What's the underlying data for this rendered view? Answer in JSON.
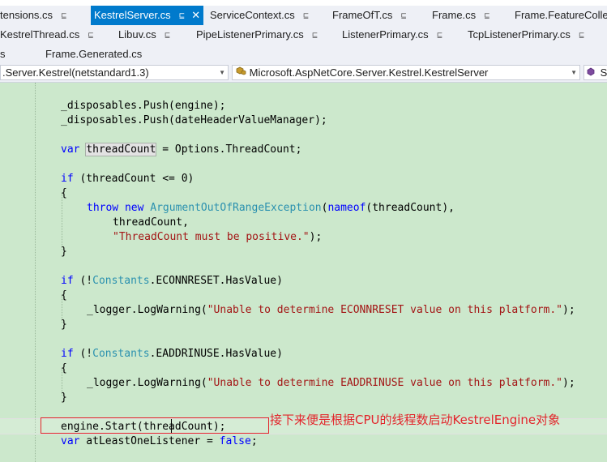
{
  "tabs": {
    "row1": [
      {
        "label": "tensions.cs",
        "active": false
      },
      {
        "label": "KestrelServer.cs",
        "active": true
      },
      {
        "label": "ServiceContext.cs",
        "active": false
      },
      {
        "label": "FrameOfT.cs",
        "active": false
      },
      {
        "label": "Frame.cs",
        "active": false
      },
      {
        "label": "Frame.FeatureColle",
        "active": false
      }
    ],
    "row2": [
      {
        "label": "KestrelThread.cs"
      },
      {
        "label": "Libuv.cs"
      },
      {
        "label": "PipeListenerPrimary.cs"
      },
      {
        "label": "ListenerPrimary.cs"
      },
      {
        "label": "TcpListenerPrimary.cs"
      }
    ],
    "row3": [
      {
        "label": "s"
      },
      {
        "label": "Frame.Generated.cs"
      }
    ],
    "pin_glyph": "⊑",
    "close_glyph": "✕"
  },
  "navbar": {
    "project": ".Server.Kestrel(netstandard1.3)",
    "type": "Microsoft.AspNetCore.Server.Kestrel.KestrelServer",
    "member": "S"
  },
  "code": {
    "l1_a": "_disposables",
    "l1_b": ".Push(engine);",
    "l2_a": "_disposables",
    "l2_b": ".Push(dateHeaderValueManager);",
    "l3_kw": "var",
    "l3_var": "threadCount",
    "l3_rest": " = Options.ThreadCount;",
    "l4_kw": "if",
    "l4_rest": " (threadCount <= 0)",
    "brace_open": "{",
    "brace_close": "}",
    "l5_kw1": "throw",
    "l5_kw2": "new",
    "l5_type": "ArgumentOutOfRangeException",
    "l5_kw3": "nameof",
    "l5_rest": "(threadCount),",
    "l5_paren": "(",
    "l6": "threadCount,",
    "l7_str": "\"ThreadCount must be positive.\"",
    "l7_rest": ");",
    "l8_kw": "if",
    "l8_pre": " (!",
    "l8_type": "Constants",
    "l8_rest": ".ECONNRESET.HasValue)",
    "l9_a": "_logger",
    "l9_b": ".LogWarning(",
    "l9_str": "\"Unable to determine ECONNRESET value on this platform.\"",
    "l9_end": ");",
    "l10_kw": "if",
    "l10_pre": " (!",
    "l10_type": "Constants",
    "l10_rest": ".EADDRINUSE.HasValue)",
    "l11_a": "_logger",
    "l11_b": ".LogWarning(",
    "l11_str": "\"Unable to determine EADDRINUSE value on this platform.\"",
    "l11_end": ");",
    "l12": "engine.Start(threadCount);",
    "l13_kw": "var",
    "l13_rest": " atLeastOneListener = ",
    "l13_kw2": "false",
    "l13_end": ";"
  },
  "annotation": "接下来便是根据CPU的线程数启动KestrelEngine对象",
  "colors": {
    "editor_bg": "#cce8cc",
    "keyword": "#0000ff",
    "type": "#2b91af",
    "string": "#a31515",
    "active_tab": "#007acc",
    "annotation": "#e2262b"
  }
}
